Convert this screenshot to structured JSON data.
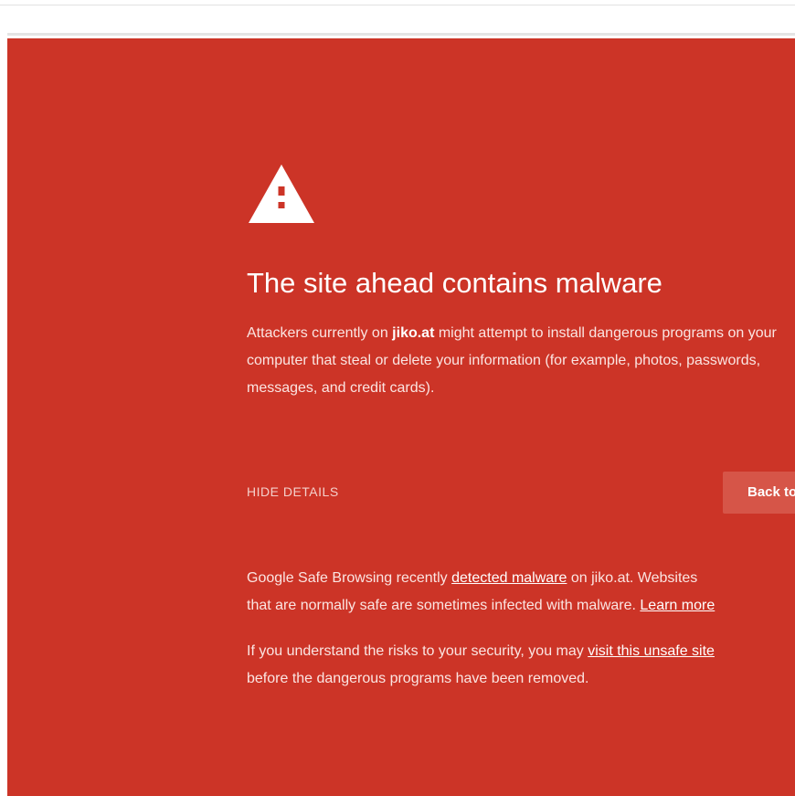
{
  "warning": {
    "heading": "The site ahead contains malware",
    "primary_prefix": "Attackers currently on ",
    "site_name": "jiko.at",
    "primary_suffix": " might attempt to install dangerous programs on your computer that steal or delete your information (for example, photos, passwords, messages, and credit cards).",
    "details_toggle": "HIDE DETAILS",
    "back_button": "Back to safety"
  },
  "details": {
    "line1_prefix": "Google Safe Browsing recently ",
    "line1_link": "detected malware",
    "line1_suffix": " on jiko.at. Websites",
    "line2_prefix": "that are normally safe are sometimes infected with malware. ",
    "line2_link": "Learn more",
    "line3_prefix": "If you understand the risks to your security, you may ",
    "line3_link": "visit this unsafe site",
    "line4": "before the dangerous programs have been removed."
  },
  "colors": {
    "background": "#cc3427",
    "button": "#d65548",
    "text": "#ffffff"
  },
  "icons": {
    "warning": "warning-triangle-icon"
  }
}
